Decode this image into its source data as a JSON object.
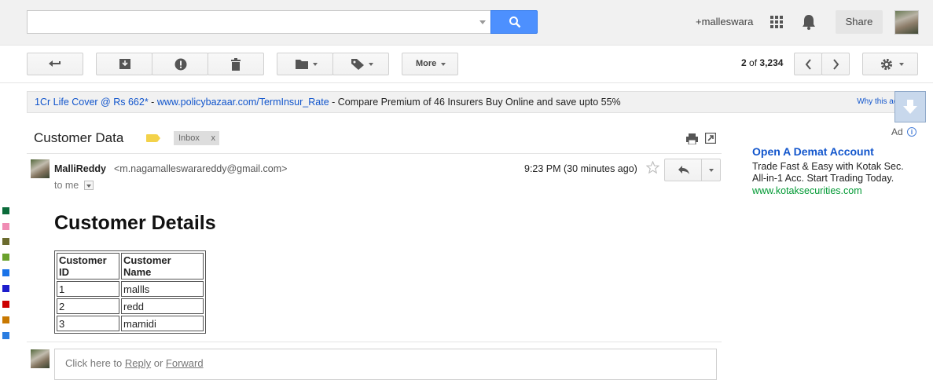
{
  "header": {
    "search_value": "",
    "user_link": "+malleswara",
    "share_label": "Share"
  },
  "toolbar": {
    "more_label": "More",
    "pager_current": "2",
    "pager_of": "of",
    "pager_total": "3,234"
  },
  "ad_strip": {
    "headline": "1Cr Life Cover @ Rs 662*",
    "separator": " - ",
    "url": "www.policybazaar.com/TermInsur_Rate",
    "text": " - Compare Premium of 46 Insurers Buy Online and save upto 55%",
    "why_label": "Why this ad?"
  },
  "message": {
    "subject": "Customer Data",
    "label_chip": "Inbox",
    "label_remove": "x",
    "sender_name": "MalliReddy",
    "sender_email": "<m.nagamalleswarareddy@gmail.com>",
    "to_line": "to me",
    "timestamp": "9:23 PM (30 minutes ago)",
    "heading": "Customer Details",
    "table": {
      "headers": [
        "Customer ID",
        "Customer Name"
      ],
      "rows": [
        [
          "1",
          "mallls"
        ],
        [
          "2",
          "redd"
        ],
        [
          "3",
          "mamidi"
        ]
      ]
    }
  },
  "reply_area": {
    "prefix": "Click here to ",
    "reply_link": "Reply",
    "or_text": " or ",
    "forward_link": "Forward"
  },
  "side_ad": {
    "ad_label": "Ad",
    "info_glyph": "i",
    "title": "Open A Demat Account",
    "line1": "Trade Fast & Easy with Kotak Sec.",
    "line2": "All-in-1 Acc. Start Trading Today.",
    "url": "www.kotaksecurities.com"
  },
  "label_colors": [
    "#0b6b3a",
    "#f08cb4",
    "#6b6b2e",
    "#6aa12c",
    "#1a73e8",
    "#1d1dcc",
    "#cc0000",
    "#c87800",
    "#2a7de1"
  ],
  "colors": {
    "accent_blue": "#4d90fe",
    "link_blue": "#1155cc",
    "ad_green": "#009933",
    "label_yellow": "#f3d24a"
  }
}
